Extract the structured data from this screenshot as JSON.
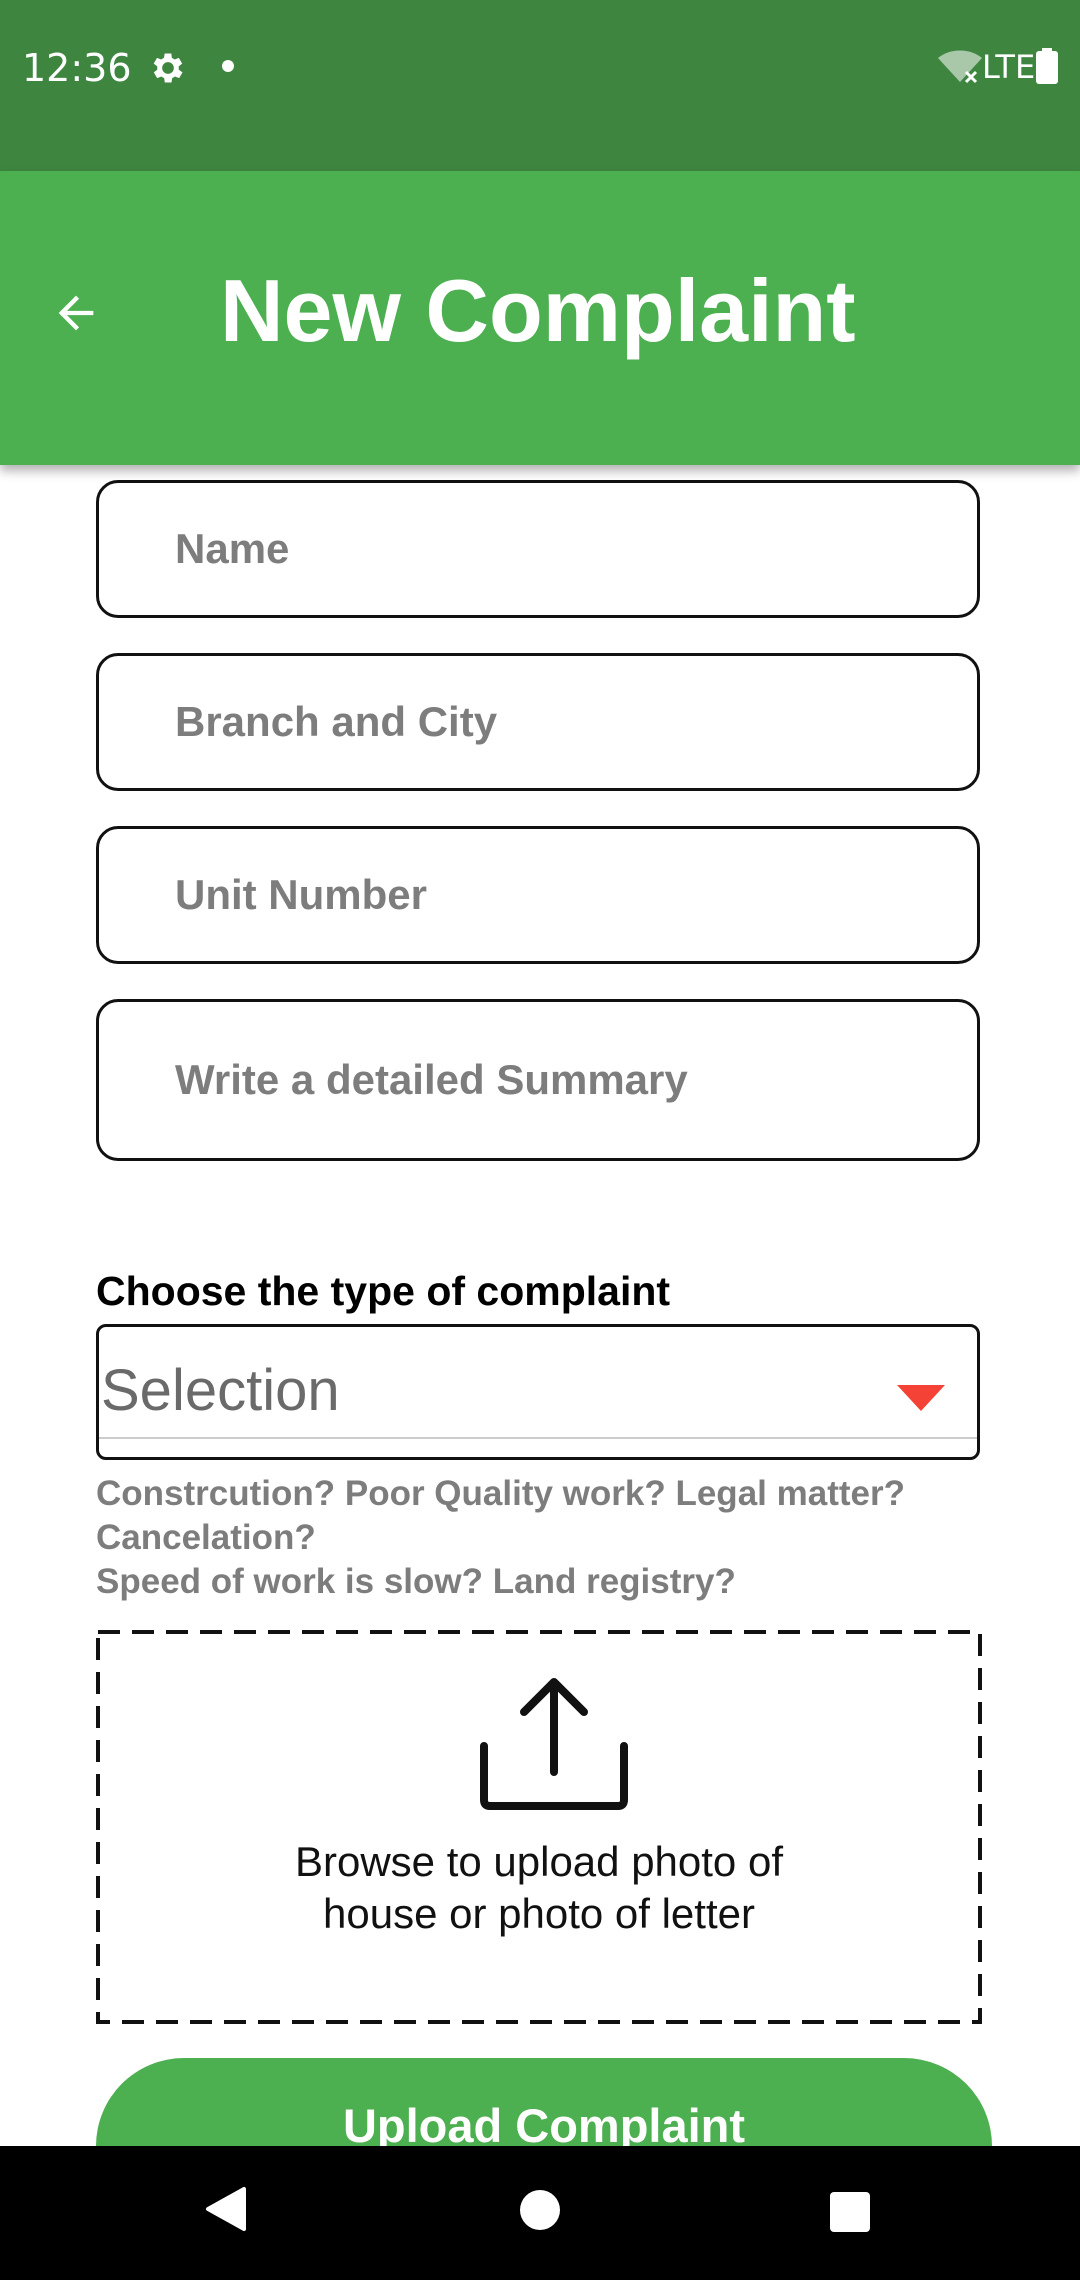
{
  "status_bar": {
    "time": "12:36",
    "network": "LTE",
    "icons": [
      "gear-icon",
      "notification-dot-icon",
      "wifi-off-icon",
      "battery-icon"
    ]
  },
  "app_bar": {
    "title": "New Complaint",
    "back_icon": "arrow-left-icon",
    "color": "#4caf50",
    "status_color": "#3e8640"
  },
  "form": {
    "name_placeholder": "Name",
    "branch_placeholder": "Branch and City",
    "unit_placeholder": "Unit Number",
    "summary_placeholder": "Write a detailed Summary",
    "type_label": "Choose the type of complaint",
    "type_selected": "Selection",
    "type_arrow_color": "#f44336",
    "hint_lines": [
      "Constrcution? Poor Quality work? Legal matter?",
      "Cancelation?",
      "Speed of work is slow? Land registry?"
    ],
    "upload_icon": "upload-icon",
    "upload_text_lines": [
      "Browse to upload photo of",
      "house or photo of letter"
    ],
    "submit_label": "Upload Complaint"
  },
  "nav_bar": {
    "icons": [
      "back-triangle-icon",
      "home-circle-icon",
      "recents-square-icon"
    ]
  }
}
